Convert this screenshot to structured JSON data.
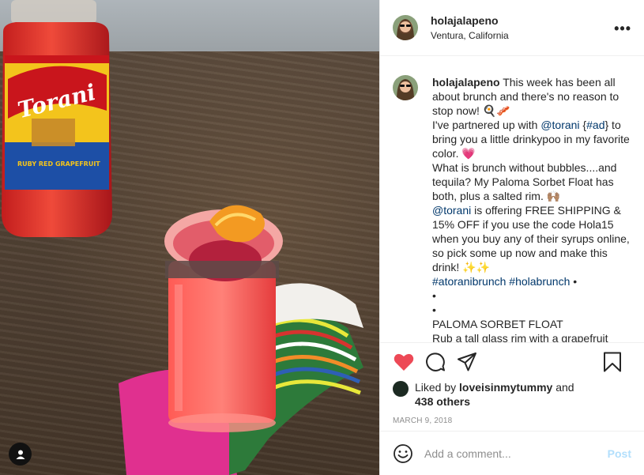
{
  "post": {
    "username": "holajalapeno",
    "location": "Ventura, California",
    "photo_brand_text": "Torani",
    "photo_label_text": "RUBY RED GRAPEFRUIT"
  },
  "caption": {
    "username": "holajalapeno",
    "lines": [
      " This week has been all about brunch and there's no reason to stop now! 🍳🥓",
      "I've partnered up with ",
      "@torani",
      " {",
      "#ad",
      "} to bring you a little drinkypoo in my favorite color. 💗",
      "What is brunch without bubbles....and tequila? My Paloma Sorbet Float has both, plus a salted rim. 🙌🏽",
      "@torani",
      " is offering FREE SHIPPING & 15% OFF if you use the code Hola15 when you buy any of their syrups online, so pick some up now and make this drink! ✨✨",
      "#atoranibrunch",
      " ",
      "#holabrunch",
      " •",
      "•",
      "•",
      "PALOMA SORBET FLOAT",
      "Rub a tall glass rim with a grapefruit"
    ]
  },
  "likes": {
    "prefix": "Liked by ",
    "user": "loveisinmytummy",
    "and": " and",
    "others": "438 others"
  },
  "date": "MARCH 9, 2018",
  "comment": {
    "placeholder": "Add a comment...",
    "post_label": "Post"
  },
  "icons": {
    "more": "more-options-icon",
    "like": "heart-icon",
    "comment": "comment-icon",
    "share": "share-icon",
    "save": "bookmark-icon",
    "emoji": "smile-icon",
    "tag": "user-tag-icon"
  },
  "colors": {
    "like_active": "#ed4956",
    "link": "#00376b",
    "post_disabled": "#b2dffc",
    "muted": "#8e8e8e"
  }
}
